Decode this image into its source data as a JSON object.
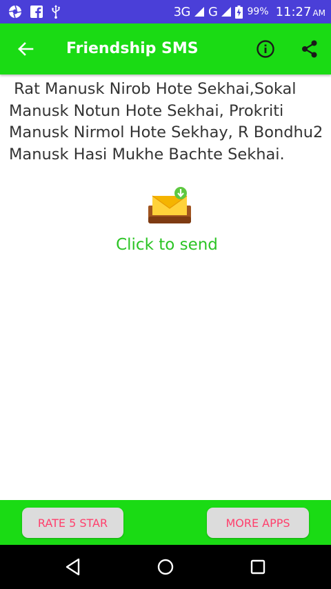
{
  "status_bar": {
    "network_1": "3G",
    "network_2": "G",
    "battery": "99%",
    "time": "11:27",
    "ampm": "AM",
    "icons": [
      "aperture-icon",
      "facebook-icon",
      "usb-icon",
      "signal-icon",
      "battery-icon"
    ]
  },
  "app_bar": {
    "title": "Friendship SMS",
    "icons": [
      "arrow-left-icon",
      "info-icon",
      "share-icon"
    ],
    "color": "#1adb14"
  },
  "message": {
    "text": " Rat Manusk Nirob Hote Sekhai,Sokal Manusk Notun Hote Sekhai, Prokriti Manusk Nirmol Hote Sekhay, R Bondhu2 Manusk Hasi Mukhe Bachte Sekhai."
  },
  "send": {
    "label": "Click to send",
    "icon": "mail-download-icon",
    "color": "#2cc425"
  },
  "bottom_bar": {
    "rate_label": "RATE 5 STAR",
    "more_label": "MORE APPS",
    "button_text_color": "#ff3f6c"
  },
  "nav_bar": {
    "icons": [
      "nav-back-icon",
      "nav-home-icon",
      "nav-recents-icon"
    ]
  }
}
